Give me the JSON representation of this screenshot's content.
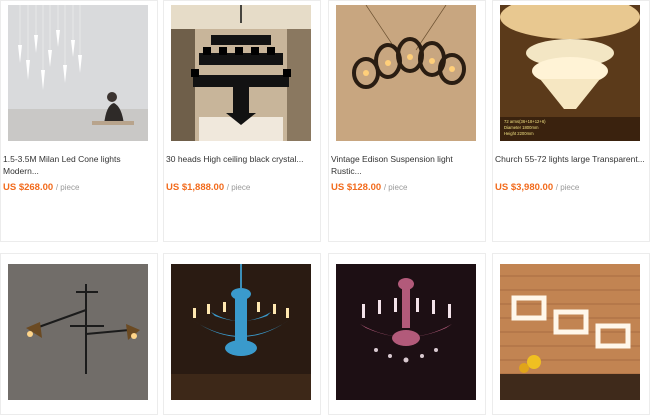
{
  "products": [
    {
      "title_line1": "1.5-3.5M Milan Led Cone lights",
      "title_line2": "Modern...",
      "price": "US $268.00",
      "unit": "/ piece",
      "image": "cone-pendant-lights"
    },
    {
      "title_line1": "30 heads High ceiling black crystal...",
      "title_line2": "",
      "price": "US $1,888.00",
      "unit": "/ piece",
      "image": "black-crystal-chandelier"
    },
    {
      "title_line1": "Vintage Edison Suspension light",
      "title_line2": "Rustic...",
      "price": "US $128.00",
      "unit": "/ piece",
      "image": "edison-suspension-light"
    },
    {
      "title_line1": "Church 55-72 lights large Transparent...",
      "title_line2": "",
      "price": "US $3,980.00",
      "unit": "/ piece",
      "image": "transparent-crystal-chandelier",
      "image_text": [
        "72 arms(36+18+12+6)",
        "Diameter 1800mm",
        "Height 2200mm"
      ]
    },
    {
      "title_line1": "",
      "title_line2": "",
      "price": "",
      "unit": "",
      "image": "industrial-wall-lamp"
    },
    {
      "title_line1": "",
      "title_line2": "",
      "price": "",
      "unit": "",
      "image": "blue-crystal-chandelier"
    },
    {
      "title_line1": "",
      "title_line2": "",
      "price": "",
      "unit": "",
      "image": "pink-crystal-chandelier"
    },
    {
      "title_line1": "",
      "title_line2": "",
      "price": "",
      "unit": "",
      "image": "square-led-pendant"
    }
  ]
}
